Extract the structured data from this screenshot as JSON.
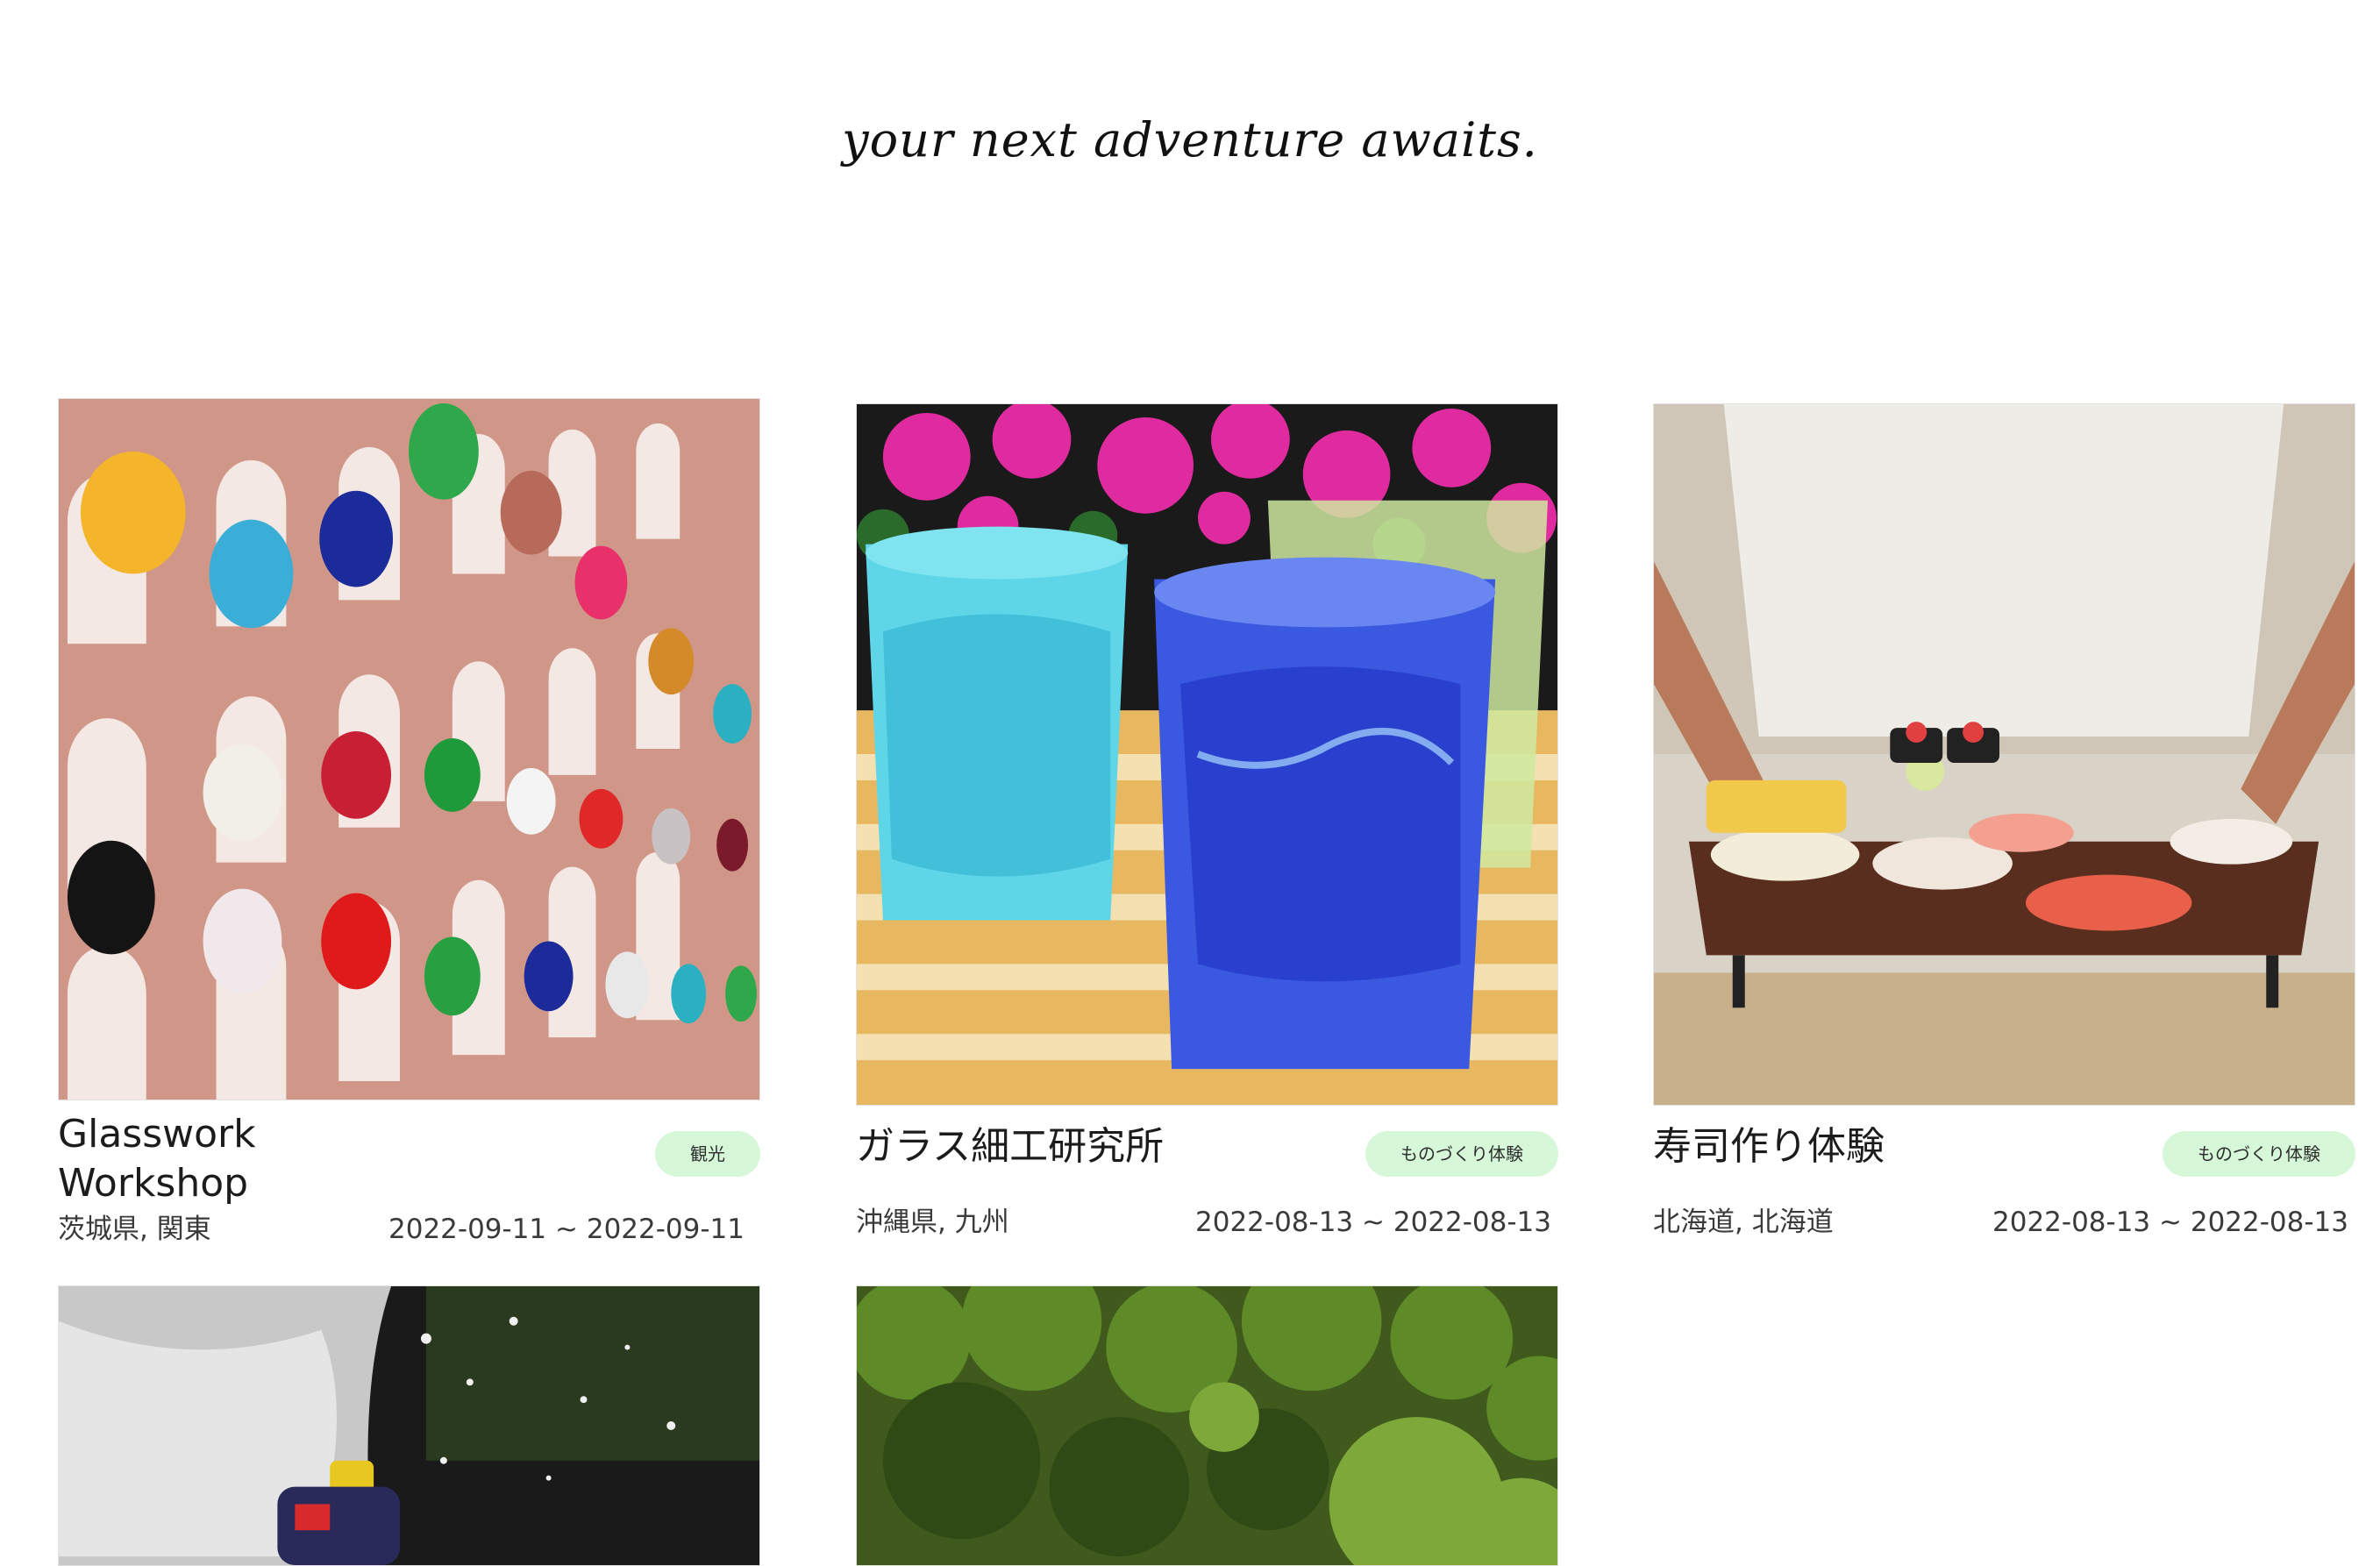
{
  "hero": {
    "tagline": "your next adventure awaits."
  },
  "cards": [
    {
      "title_line1": "Glasswork",
      "title_line2": "Workshop",
      "category": "観光",
      "location": "茨城県, 関東",
      "dates": "2022-09-11 ~ 2022-09-11",
      "image_subject": "colorful glass vases on pink wall"
    },
    {
      "title": "ガラス細工研究所",
      "category": "ものづくり体験",
      "location": "沖縄県, 九州",
      "dates": "2022-08-13 ~ 2022-08-13",
      "image_subject": "blue glass tumblers with flowers"
    },
    {
      "title": "寿司作り体験",
      "category": "ものづくり体験",
      "location": "北海道, 北海道",
      "dates": "2022-08-13 ~ 2022-08-13",
      "image_subject": "sushi platter held by chef"
    },
    {
      "image_subject": "water splash rafting"
    },
    {
      "image_subject": "green forest foliage"
    }
  ],
  "colors": {
    "badge_bg": "#d6f7d8",
    "text": "#1c1c1c"
  }
}
